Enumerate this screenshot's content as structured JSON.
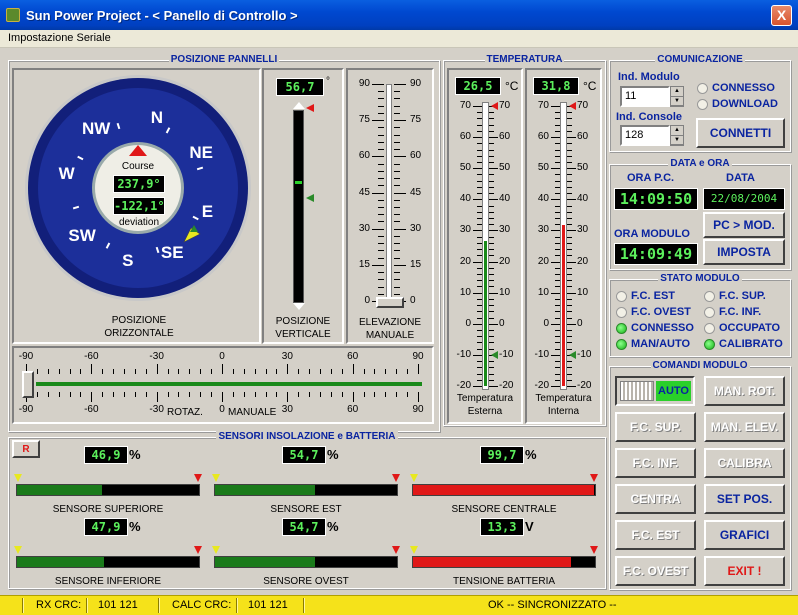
{
  "window": {
    "title": "Sun Power Project - < Panello di Controllo >",
    "close": "X"
  },
  "menu": {
    "item": "Impostazione Seriale"
  },
  "posizione": {
    "group_title": "POSIZIONE PANNELLI",
    "compass": {
      "dirs": [
        "SW",
        "W",
        "NW",
        "N",
        "NE",
        "E",
        "SE",
        "S"
      ],
      "course_label": "Course",
      "course_value": "237,9°",
      "deviation_value": "-122,1°",
      "deviation_label": "deviation"
    },
    "orizzontale_label": [
      "POSIZIONE",
      "ORIZZONTALE"
    ],
    "verticale": {
      "value": "56,7",
      "unit": "°",
      "label": [
        "POSIZIONE",
        "VERTICALE"
      ]
    },
    "elevazione": {
      "ticks": [
        "90",
        "75",
        "60",
        "45",
        "30",
        "15",
        "0"
      ],
      "label": [
        "ELEVAZIONE",
        "MANUALE"
      ]
    },
    "rotazione": {
      "ticks": [
        "-90",
        "-60",
        "-30",
        "0",
        "30",
        "60",
        "90"
      ],
      "label_left": "ROTAZ.",
      "label_right": "MANUALE"
    }
  },
  "temperatura": {
    "group_title": "TEMPERATURA",
    "unit": "°C",
    "esterna": {
      "value": "26,5",
      "label": [
        "Temperatura",
        "Esterna"
      ],
      "level_celsius": 26.5
    },
    "interna": {
      "value": "31,8",
      "label": [
        "Temperatura",
        "Interna"
      ],
      "level_celsius": 31.8
    },
    "ticks": [
      "70",
      "60",
      "50",
      "40",
      "30",
      "20",
      "10",
      "0",
      "-10",
      "-20"
    ]
  },
  "comunicazione": {
    "group_title": "COMUNICAZIONE",
    "modulo_label": "Ind. Modulo",
    "modulo_value": "11",
    "console_label": "Ind. Console",
    "console_value": "128",
    "radio_connesso": "CONNESSO",
    "radio_download": "DOWNLOAD",
    "connetti": "CONNETTI"
  },
  "data_ora": {
    "group_title": "DATA e ORA",
    "ora_pc_label": "ORA P.C.",
    "ora_pc": "14:09:50",
    "data_label": "DATA",
    "data": "22/08/2004",
    "pc_mod": "PC > MOD.",
    "ora_modulo_label": "ORA MODULO",
    "ora_modulo": "14:09:49",
    "imposta": "IMPOSTA"
  },
  "stato": {
    "group_title": "STATO MODULO",
    "items": [
      {
        "label": "F.C. EST",
        "on": false
      },
      {
        "label": "F.C. SUP.",
        "on": false
      },
      {
        "label": "F.C. OVEST",
        "on": false
      },
      {
        "label": "F.C. INF.",
        "on": false
      },
      {
        "label": "CONNESSO",
        "on": true
      },
      {
        "label": "OCCUPATO",
        "on": false
      },
      {
        "label": "MAN/AUTO",
        "on": true
      },
      {
        "label": "CALIBRATO",
        "on": true
      }
    ]
  },
  "comandi": {
    "group_title": "COMANDI MODULO",
    "auto": "AUTO",
    "buttons": [
      "MAN. ROT.",
      "F.C. SUP.",
      "MAN. ELEV.",
      "F.C. INF.",
      "CALIBRA",
      "CENTRA",
      "SET POS.",
      "F.C. EST",
      "GRAFICI",
      "F.C. OVEST",
      "EXIT !"
    ]
  },
  "sensori": {
    "group_title": "SENSORI INSOLAZIONE e BATTERIA",
    "reset": "R",
    "items": [
      {
        "value": "46,9",
        "unit": "%",
        "label": "SENSORE SUPERIORE",
        "level": 0.469,
        "color": "#1a7a1a"
      },
      {
        "value": "54,7",
        "unit": "%",
        "label": "SENSORE EST",
        "level": 0.547,
        "color": "#1a7a1a"
      },
      {
        "value": "99,7",
        "unit": "%",
        "label": "SENSORE CENTRALE",
        "level": 0.997,
        "color": "#e01818"
      },
      {
        "value": "47,9",
        "unit": "%",
        "label": "SENSORE INFERIORE",
        "level": 0.479,
        "color": "#1a7a1a"
      },
      {
        "value": "54,7",
        "unit": "%",
        "label": "SENSORE OVEST",
        "level": 0.547,
        "color": "#1a7a1a"
      },
      {
        "value": "13,3",
        "unit": "V",
        "label": "TENSIONE BATTERIA",
        "level": 0.87,
        "color": "#e01818"
      }
    ]
  },
  "status": {
    "rx_label": "RX CRC:",
    "rx_value": "101 121",
    "calc_label": "CALC CRC:",
    "calc_value": "101 121",
    "message": "OK  -- SINCRONIZZATO --"
  }
}
